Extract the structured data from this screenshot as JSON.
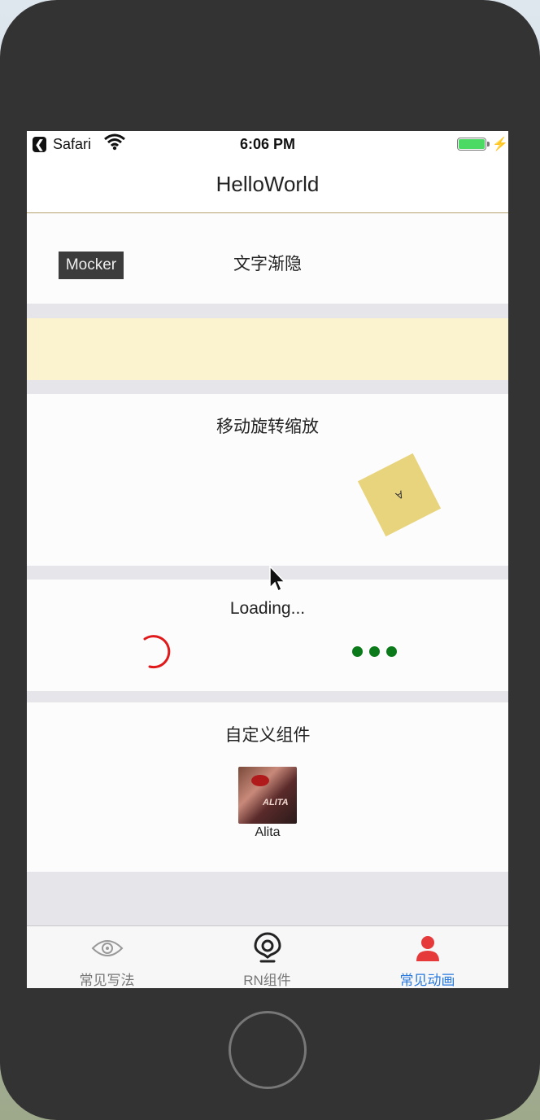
{
  "status_bar": {
    "back_glyph": "❮",
    "carrier": "Safari",
    "time": "6:06 PM",
    "bolt": "⚡"
  },
  "nav": {
    "title": "HelloWorld"
  },
  "sections": {
    "fade": {
      "title": "文字渐隐",
      "mocker_label": "Mocker"
    },
    "transform": {
      "title": "移动旋转缩放",
      "square_label": "A"
    },
    "loading": {
      "title": "Loading..."
    },
    "custom": {
      "title": "自定义组件",
      "thumb_label": "Alita",
      "thumb_logo": "ALITA"
    }
  },
  "tabs": [
    {
      "label": "常见写法",
      "icon": "eye-icon",
      "active": false
    },
    {
      "label": "RN组件",
      "icon": "location-pin-icon",
      "active": false
    },
    {
      "label": "常见动画",
      "icon": "person-icon",
      "active": true
    }
  ],
  "colors": {
    "accent_active": "#2a7adf",
    "battery": "#4cd964",
    "spinner": "#e0191b",
    "dots": "#0b7a1a",
    "tab_person": "#e63a3a"
  }
}
